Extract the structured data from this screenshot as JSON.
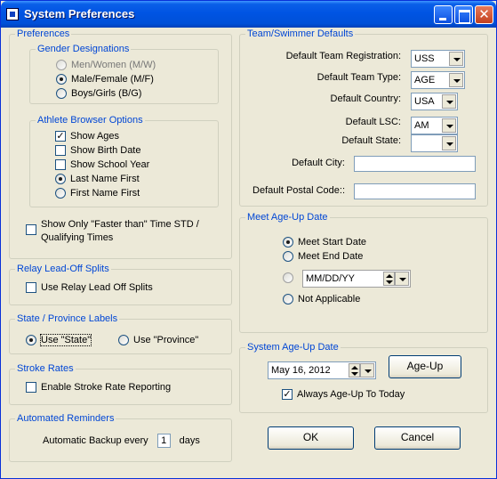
{
  "window": {
    "title": "System Preferences",
    "close_glyph": "✕"
  },
  "preferences": {
    "legend": "Preferences",
    "gender": {
      "legend": "Gender Designations",
      "options": [
        "Men/Women (M/W)",
        "Male/Female (M/F)",
        "Boys/Girls (B/G)"
      ],
      "selected_index": 1
    },
    "athlete_browser": {
      "legend": "Athlete Browser Options",
      "checks": [
        {
          "label": "Show Ages",
          "checked": true
        },
        {
          "label": "Show Birth Date",
          "checked": false
        },
        {
          "label": "Show School Year",
          "checked": false
        }
      ],
      "radios": [
        {
          "label": "Last Name First",
          "selected": true
        },
        {
          "label": "First Name First",
          "selected": false
        }
      ]
    },
    "faster_than": {
      "line1": "Show Only   \"Faster than\" Time STD /",
      "line2": "Qualifying Times",
      "checked": false
    }
  },
  "relay": {
    "legend": "Relay Lead-Off Splits",
    "label": "Use Relay Lead Off Splits",
    "checked": false
  },
  "state_province": {
    "legend": "State / Province Labels",
    "state_label": "Use \"State\"",
    "province_label": "Use \"Province\"",
    "selected": "state"
  },
  "stroke_rates": {
    "legend": "Stroke Rates",
    "label": "Enable Stroke Rate Reporting",
    "checked": false
  },
  "reminders": {
    "legend": "Automated Reminders",
    "prefix": "Automatic Backup every",
    "value": "1",
    "suffix": "days"
  },
  "team_defaults": {
    "legend": "Team/Swimmer Defaults",
    "registration": {
      "label": "Default Team Registration:",
      "value": "USS"
    },
    "team_type": {
      "label": "Default Team Type:",
      "value": "AGE"
    },
    "country": {
      "label": "Default Country:",
      "value": "USA"
    },
    "lsc": {
      "label": "Default LSC:",
      "value": "AM"
    },
    "state": {
      "label": "Default State:",
      "value": ""
    },
    "city": {
      "label": "Default City:",
      "value": ""
    },
    "postal": {
      "label": "Default Postal Code::",
      "value": ""
    }
  },
  "meet_ageup": {
    "legend": "Meet Age-Up Date",
    "options": [
      "Meet Start Date",
      "Meet End Date",
      "",
      "Not Applicable"
    ],
    "selected_index": 0,
    "date_placeholder": "MM/DD/YY"
  },
  "system_ageup": {
    "legend": "System Age-Up Date",
    "date": "May 16, 2012",
    "button": "Age-Up",
    "always_label": "Always Age-Up To Today",
    "always_checked": true
  },
  "buttons": {
    "ok": "OK",
    "cancel": "Cancel"
  }
}
